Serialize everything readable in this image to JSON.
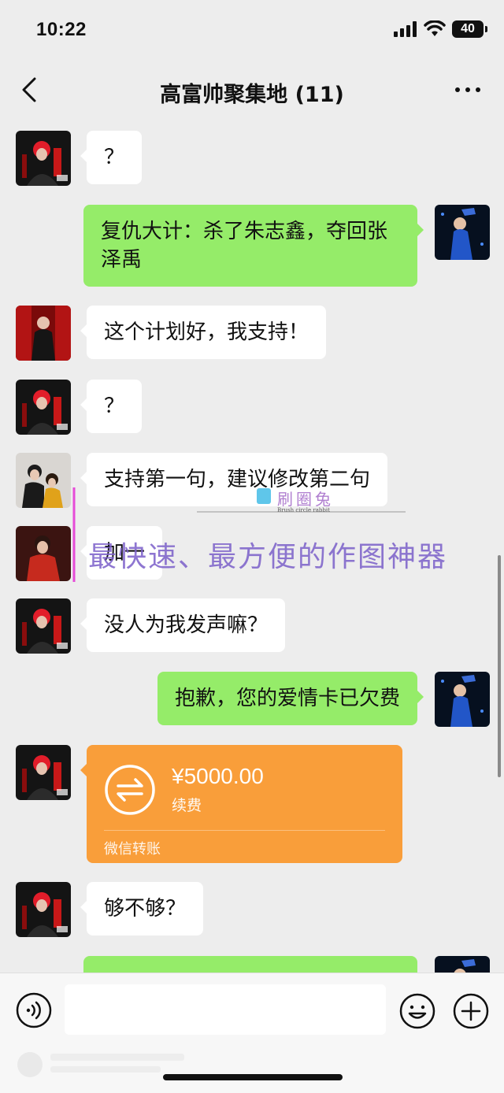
{
  "status_bar": {
    "time": "10:22",
    "battery": "40"
  },
  "nav": {
    "title": "高富帅聚集地 (11)"
  },
  "messages": [
    {
      "side": "left",
      "avatar": "red-hair-avatar",
      "text": "？"
    },
    {
      "side": "right",
      "avatar": "blue-outfit-avatar",
      "text": "复仇大计：杀了朱志鑫，夺回张泽禹"
    },
    {
      "side": "left",
      "avatar": "red-stage-avatar",
      "text": "这个计划好，我支持！"
    },
    {
      "side": "left",
      "avatar": "red-hair-avatar",
      "text": "？"
    },
    {
      "side": "left",
      "avatar": "duo-avatar",
      "text": "支持第一句，建议修改第二句"
    },
    {
      "side": "left",
      "avatar": "red-jacket-avatar",
      "text": "加一"
    },
    {
      "side": "left",
      "avatar": "red-hair-avatar",
      "text": "没人为我发声嘛？"
    },
    {
      "side": "right",
      "avatar": "blue-outfit-avatar",
      "text": "抱歉，您的爱情卡已欠费"
    },
    {
      "side": "left",
      "avatar": "red-hair-avatar",
      "type": "transfer"
    },
    {
      "side": "left",
      "avatar": "red-hair-avatar",
      "text": "够不够？"
    }
  ],
  "transfer": {
    "amount": "¥5000.00",
    "note": "续费",
    "label": "微信转账"
  },
  "watermark": {
    "brand": "刷圈兔",
    "brand_sub": "Brush circle rabbit",
    "tagline": "最快速、最方便的作图神器"
  }
}
